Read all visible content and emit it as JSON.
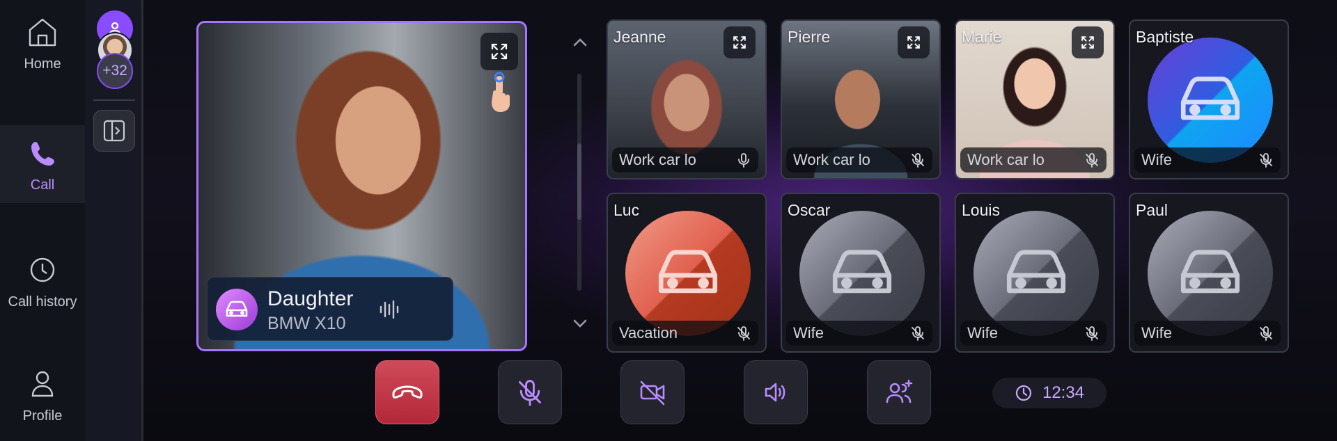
{
  "nav": {
    "items": [
      {
        "label": "Home",
        "icon": "home-icon",
        "active": false
      },
      {
        "label": "Call",
        "icon": "phone-icon",
        "active": true
      },
      {
        "label": "Call history",
        "icon": "clock-icon",
        "active": false
      },
      {
        "label": "Profile",
        "icon": "user-icon",
        "active": false
      }
    ]
  },
  "rail": {
    "extra_count": "+32"
  },
  "main_call": {
    "name": "Daughter",
    "vehicle": "BMW X10"
  },
  "participants": [
    {
      "name": "Jeanne",
      "label": "Work car lo",
      "mic": "on",
      "type": "video"
    },
    {
      "name": "Pierre",
      "label": "Work car lo",
      "mic": "muted",
      "type": "video"
    },
    {
      "name": "Marie",
      "label": "Work car lo",
      "mic": "muted",
      "type": "video"
    },
    {
      "name": "Baptiste",
      "label": "Wife",
      "mic": "muted",
      "type": "avatar",
      "color": "#2f5de0"
    },
    {
      "name": "Luc",
      "label": "Vacation",
      "mic": "muted",
      "type": "avatar",
      "color": "#e0604e"
    },
    {
      "name": "Oscar",
      "label": "Wife",
      "mic": "muted",
      "type": "avatar",
      "color": "#6b6d7a"
    },
    {
      "name": "Louis",
      "label": "Wife",
      "mic": "muted",
      "type": "avatar",
      "color": "#6b6d7a"
    },
    {
      "name": "Paul",
      "label": "Wife",
      "mic": "muted",
      "type": "avatar",
      "color": "#6b6d7a"
    }
  ],
  "controls": [
    "hang-up-icon",
    "mic-off-icon",
    "video-off-icon",
    "speaker-icon",
    "add-user-icon"
  ],
  "call_timer": "12:34",
  "colors": {
    "accent": "#a575ff",
    "hangup": "#c53444"
  }
}
